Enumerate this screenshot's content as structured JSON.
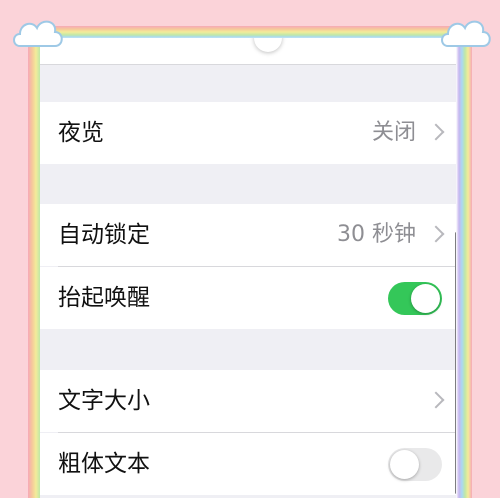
{
  "sections": [
    {
      "rows": [
        {
          "label": "夜览",
          "value": "关闭",
          "control": "chevron"
        }
      ]
    },
    {
      "rows": [
        {
          "label": "自动锁定",
          "value": "30 秒钟",
          "control": "chevron"
        },
        {
          "label": "抬起唤醒",
          "control": "toggle",
          "toggle_state": "on"
        }
      ]
    },
    {
      "rows": [
        {
          "label": "文字大小",
          "control": "chevron"
        },
        {
          "label": "粗体文本",
          "control": "toggle",
          "toggle_state": "off"
        }
      ]
    }
  ],
  "colors": {
    "background_pink": "#fbd3d9",
    "toggle_on": "#34c759",
    "toggle_off": "#e9e9ea",
    "grouped_background": "#efeff4"
  },
  "decorations": [
    "cloud-icon-left",
    "cloud-icon-right",
    "rainbow-border"
  ]
}
